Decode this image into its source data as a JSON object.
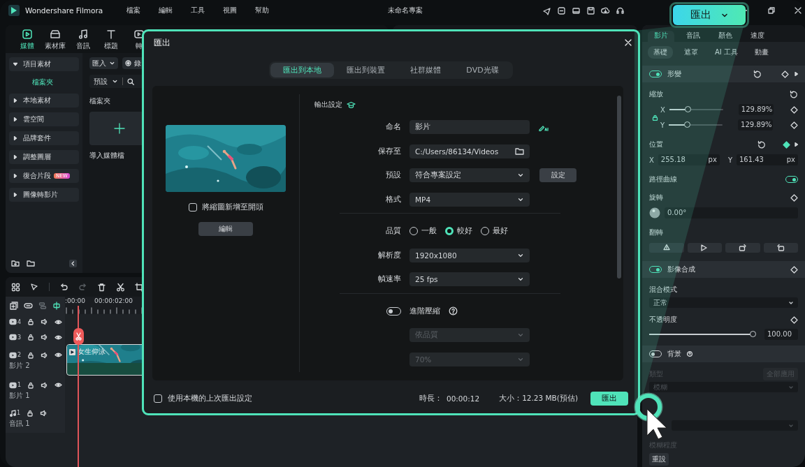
{
  "app": {
    "name": "Wondershare Filmora",
    "menu": [
      "檔案",
      "編輯",
      "工具",
      "視圖",
      "幫助"
    ],
    "project_title": "未命名專案"
  },
  "toolbar_tabs": [
    {
      "label": "媒體",
      "selected": true
    },
    {
      "label": "素材庫",
      "selected": false
    },
    {
      "label": "音訊",
      "selected": false
    },
    {
      "label": "標題",
      "selected": false
    },
    {
      "label": "轉",
      "selected": false
    }
  ],
  "media_toolbar": {
    "import": "匯入",
    "record": "錄",
    "sort": "預設"
  },
  "media_sidebar": {
    "items": [
      {
        "label": "項目素材",
        "expanded": true,
        "children": [
          {
            "label": "檔案夾",
            "selected": true
          }
        ]
      },
      {
        "label": "本地素材",
        "expanded": false
      },
      {
        "label": "雲空間",
        "expanded": false
      },
      {
        "label": "品牌套件",
        "expanded": false
      },
      {
        "label": "調整圖層",
        "expanded": false
      },
      {
        "label": "復合片段",
        "expanded": false,
        "badge": "NEW"
      },
      {
        "label": "圖像轉影片",
        "expanded": false
      }
    ]
  },
  "media_content": {
    "folder_label": "檔案夾",
    "import_tile": "導入媒體檔"
  },
  "timeline": {
    "ruler": [
      ":00:00",
      "00:00:02:00"
    ],
    "tracks": [
      {
        "kind": "video",
        "number": "4"
      },
      {
        "kind": "video",
        "number": "3"
      },
      {
        "kind": "video",
        "number": "2",
        "name": "影片 2"
      },
      {
        "kind": "video",
        "number": "1",
        "name": "影片 1"
      },
      {
        "kind": "audio",
        "number": "1",
        "name": "音訊 1"
      }
    ],
    "clip": {
      "title": "女生仰泳"
    }
  },
  "export_dialog": {
    "title": "匯出",
    "tabs": [
      {
        "label": "匯出到本地",
        "selected": true
      },
      {
        "label": "匯出到裝置",
        "selected": false
      },
      {
        "label": "社群媒體",
        "selected": false
      },
      {
        "label": "DVD光碟",
        "selected": false
      }
    ],
    "thumbnail_option": {
      "label": "將縮圖新增至開頭",
      "checked": false
    },
    "edit_button": "編輯",
    "section_title": "輸出設定",
    "fields": [
      {
        "kind": "text",
        "label": "命名",
        "value": "影片"
      },
      {
        "kind": "folder",
        "label": "保存至",
        "value": "C:/Users/86134/Videos"
      },
      {
        "kind": "select",
        "label": "預設",
        "value": "符合專案設定",
        "button": "設定"
      },
      {
        "kind": "select",
        "label": "格式",
        "value": "MP4"
      },
      {
        "kind": "divider"
      },
      {
        "kind": "radio",
        "label": "品質",
        "options": [
          {
            "label": "一般",
            "selected": false
          },
          {
            "label": "較好",
            "selected": true
          },
          {
            "label": "最好",
            "selected": false
          }
        ]
      },
      {
        "kind": "select",
        "label": "解析度",
        "value": "1920x1080"
      },
      {
        "kind": "select",
        "label": "幀速率",
        "value": "25 fps"
      },
      {
        "kind": "divider"
      },
      {
        "kind": "toggle",
        "label": "進階壓縮",
        "on": false
      },
      {
        "kind": "select",
        "value": "依品質",
        "disabled": true
      },
      {
        "kind": "select",
        "value": "70%",
        "disabled": true
      }
    ],
    "footer": {
      "remember": {
        "label": "使用本機的上次匯出設定",
        "checked": false
      },
      "duration_label": "時長：",
      "duration": "00:00:12",
      "size": "大小：12.23 MB(預估)",
      "export_button": "匯出"
    }
  },
  "highlight_button": {
    "label": "匯出"
  },
  "properties": {
    "tabs": [
      {
        "label": "影片",
        "selected": true
      },
      {
        "label": "音訊",
        "selected": false
      },
      {
        "label": "顏色",
        "selected": false
      },
      {
        "label": "速度",
        "selected": false
      }
    ],
    "subtabs": [
      {
        "label": "基礎",
        "selected": true
      },
      {
        "label": "遮罩",
        "selected": false
      },
      {
        "label": "AI 工具",
        "selected": false
      },
      {
        "label": "動畫",
        "selected": false
      }
    ],
    "transform": {
      "label": "形變",
      "on": true
    },
    "scale": {
      "label": "縮放",
      "x": {
        "axis": "X",
        "level": 0.34,
        "value": "129.89",
        "unit": "%"
      },
      "y": {
        "axis": "Y",
        "level": 0.34,
        "value": "129.89",
        "unit": "%"
      }
    },
    "position": {
      "label": "位置",
      "x": {
        "axis": "X",
        "value": "255.18",
        "unit": "px"
      },
      "y": {
        "axis": "Y",
        "value": "161.43",
        "unit": "px"
      }
    },
    "path_curve": {
      "label": "路徑曲線",
      "on": true
    },
    "rotation": {
      "label": "旋轉",
      "value": "0.00°"
    },
    "flip": {
      "label": "翻轉"
    },
    "compositing": {
      "label": "影像合成",
      "on": true
    },
    "blend_mode": {
      "label": "混合模式",
      "value": "正常"
    },
    "opacity": {
      "label": "不透明度",
      "level": 1.0,
      "value": "100.00"
    },
    "background": {
      "label": "背景",
      "on": false
    },
    "bg_type": {
      "label": "類型",
      "apply_all": "全部應用",
      "value": "模糊"
    },
    "blur_level": {
      "label": "模糊程度"
    },
    "reset": "重設"
  }
}
